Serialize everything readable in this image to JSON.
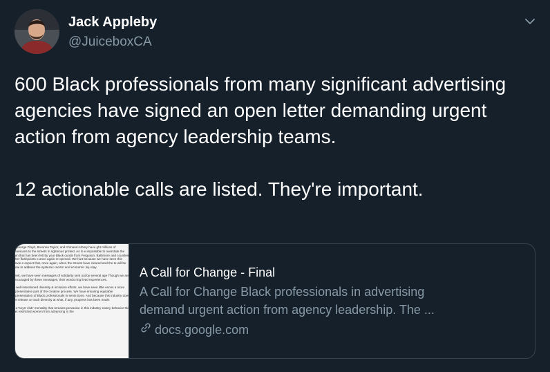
{
  "author": {
    "name": "Jack Appleby",
    "handle": "@JuiceboxCA"
  },
  "tweet": {
    "paragraphs": [
      "600 Black professionals from many significant advertising agencies have signed an open letter demanding urgent action from agency leadership teams.",
      "12 actionable calls are listed. They're important."
    ]
  },
  "card": {
    "title": "A Call for Change - Final",
    "description_lines": [
      "A Call for Change Black professionals in advertising",
      "demand urgent action from agency leadership. The ..."
    ],
    "domain": "docs.google.com",
    "thumbnail_paragraphs": [
      "of George Floyd, Breonna Taylor, and Ahmaud Arbery have ght millions of Americans to the streets in righteous protest. As lo e impossible to overstate the pain that has been felt by your Black ounds from Ferguson, Baltimore and countless other flashpoints o ance again re-opened. We hurt because we have seen this movie e expect that, once again, when the streets have cleared and the te will be done to address the systemic racism and economic inju day.",
      "week, we have seen messages of solidarity sent out by several age Though we are encouraged by these messages, their words ring lived experiences.",
      "of well-intentioned diversity & inclusion efforts, we have seen little ences a more representative part of the creative process. We have ensuring equitable representation of Black professionals in senio tions. And because this industry does not release or track diversity at what, if any, progress has been made.",
      "is a 'boys' club' mentality that remains pervasive in this industry eatory behavior that has restricted women from advancing in the"
    ]
  },
  "icons": {
    "caret": "chevron-down-icon",
    "link": "link-icon"
  },
  "colors": {
    "background": "#15202b",
    "primary_text": "#ffffff",
    "secondary_text": "#8899a6",
    "border": "#38444d"
  }
}
